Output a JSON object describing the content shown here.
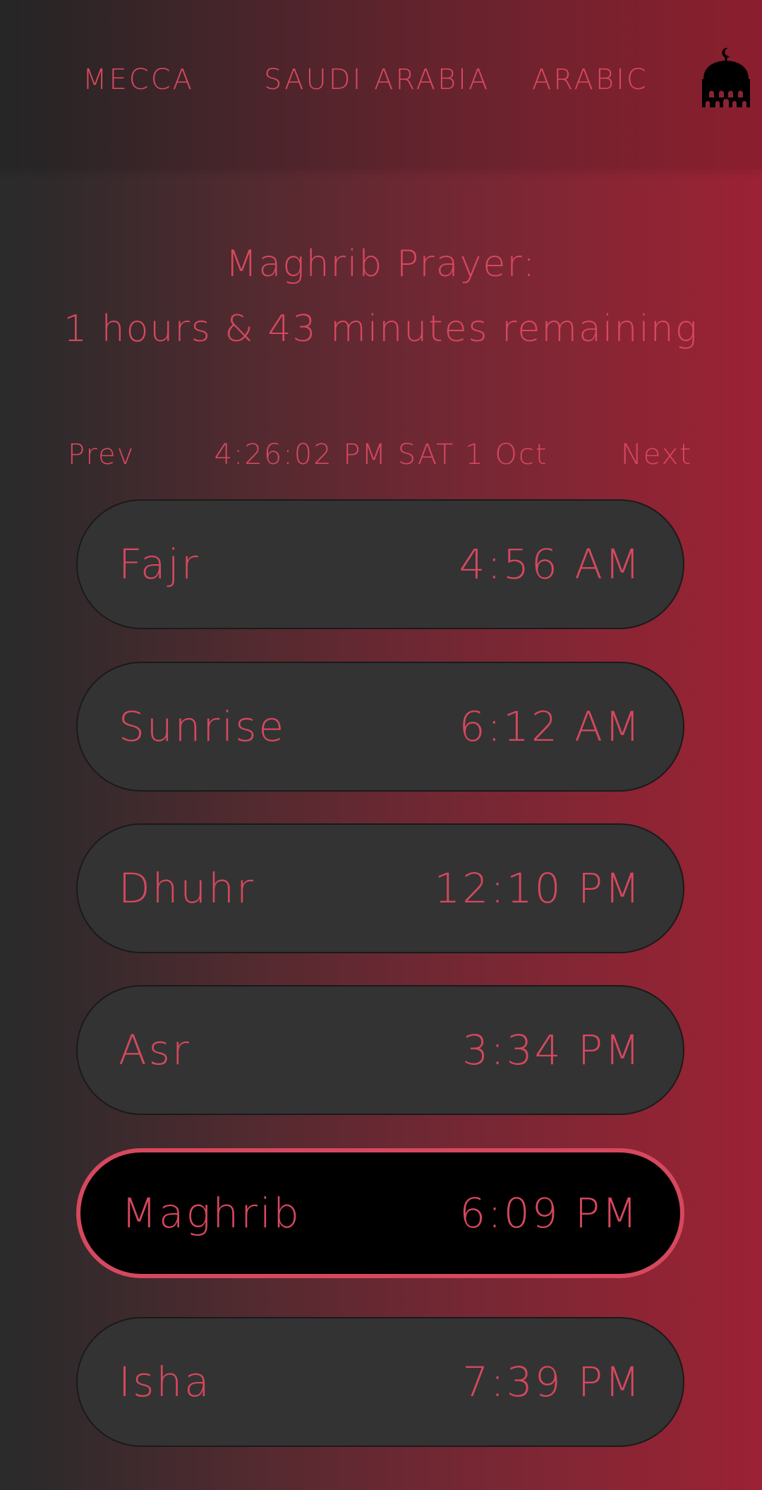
{
  "header": {
    "city": "MECCA",
    "country": "SAUDI ARABIA",
    "language": "ARABIC",
    "icon": "mosque-icon"
  },
  "countdown": {
    "title": "Maghrib Prayer:",
    "remaining": "1 hours & 43 minutes remaining"
  },
  "nav": {
    "prev": "Prev",
    "datetime": "4:26:02 PM SAT 1 Oct",
    "next": "Next"
  },
  "prayers": [
    {
      "name": "Fajr",
      "time": "4:56 AM",
      "active": false
    },
    {
      "name": "Sunrise",
      "time": "6:12 AM",
      "active": false
    },
    {
      "name": "Dhuhr",
      "time": "12:10 PM",
      "active": false
    },
    {
      "name": "Asr",
      "time": "3:34 PM",
      "active": false
    },
    {
      "name": "Maghrib",
      "time": "6:09 PM",
      "active": true
    },
    {
      "name": "Isha",
      "time": "7:39 PM",
      "active": false
    }
  ],
  "colors": {
    "accent": "#d6485e",
    "card": "#333333",
    "active_card": "#000000"
  }
}
